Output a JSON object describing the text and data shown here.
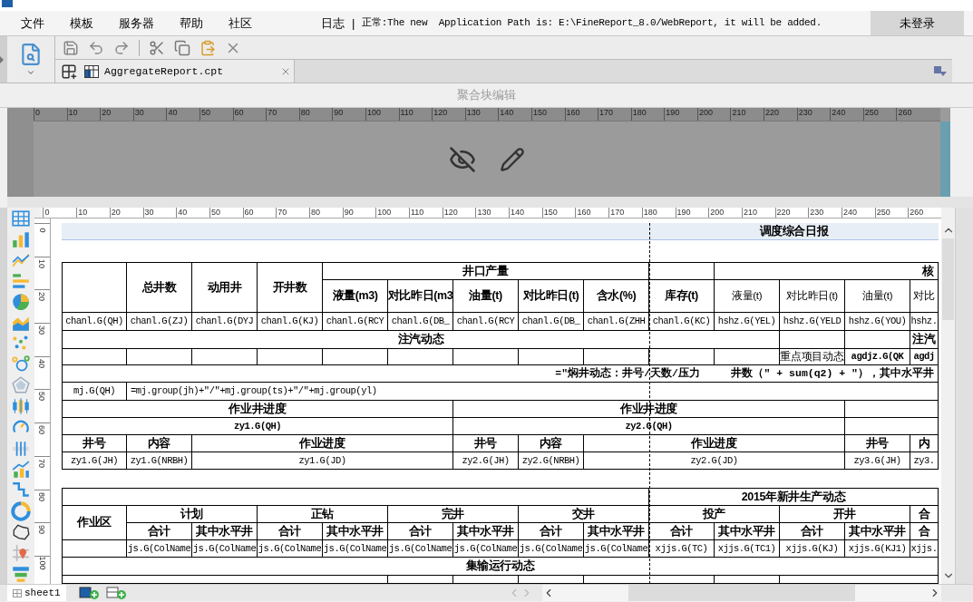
{
  "menu": [
    "文件",
    "模板",
    "服务器",
    "帮助",
    "社区"
  ],
  "log": {
    "label": "日志",
    "separator": "|",
    "message": "正常:The new  Application Path is: E:\\FineReport_8.0/WebReport, it will be added."
  },
  "login_button": "未登录",
  "tabs": [
    {
      "label": "AggregateReport.cpt",
      "selected": true
    }
  ],
  "block_title": "聚合块编辑",
  "block_ruler": [
    "0",
    "10",
    "20",
    "30",
    "40",
    "50",
    "60",
    "70",
    "80",
    "90",
    "100",
    "110",
    "120",
    "130",
    "140",
    "150",
    "160",
    "170",
    "180",
    "190",
    "200",
    "210",
    "220",
    "230",
    "240",
    "250",
    "260"
  ],
  "top_ruler": [
    "0",
    "10",
    "20",
    "30",
    "40",
    "50",
    "60",
    "70",
    "80",
    "90",
    "100",
    "110",
    "120",
    "130",
    "140",
    "150",
    "160",
    "170",
    "180",
    "190",
    "200",
    "210",
    "220",
    "230",
    "240",
    "250",
    "260"
  ],
  "side_ruler": [
    "0",
    "10",
    "20",
    "30",
    "40",
    "50",
    "60",
    "70",
    "80",
    "90",
    "100"
  ],
  "grid": {
    "rows": [
      {
        "kind": "band",
        "cells": [
          {
            "kind": "empty"
          },
          {
            "text": "调度综合日报",
            "kind": "header"
          }
        ]
      },
      {
        "kind": "blank"
      },
      {
        "kind": "cells",
        "cells": [
          {
            "kind": "empty"
          },
          {
            "text": "总井数",
            "kind": "header"
          },
          {
            "text": "动用井",
            "kind": "header"
          },
          {
            "text": "开井数",
            "kind": "header"
          },
          {
            "text": "井口产量",
            "kind": "header"
          },
          {
            "kind": "empty"
          },
          {
            "text": "核",
            "kind": "header"
          }
        ]
      },
      {
        "kind": "cells",
        "cells": [
          {
            "text": "液量(m3)",
            "kind": "header"
          },
          {
            "text": "对比昨日(m3",
            "kind": "header"
          },
          {
            "text": "油量(t)",
            "kind": "header"
          },
          {
            "text": "对比昨日(t)",
            "kind": "header"
          },
          {
            "text": "含水(%)",
            "kind": "header"
          },
          {
            "text": "库存(t)",
            "kind": "header"
          },
          {
            "text": "液量(t)",
            "kind": "label"
          },
          {
            "text": "对比昨日(t)",
            "kind": "label"
          },
          {
            "text": "油量(t)",
            "kind": "label"
          },
          {
            "text": "对比",
            "kind": "label"
          }
        ]
      },
      {
        "kind": "cells",
        "cells": [
          {
            "text": "chanl.G(QH)",
            "kind": "field"
          },
          {
            "text": "chanl.G(ZJ)",
            "kind": "field"
          },
          {
            "text": "chanl.G(DYJ",
            "kind": "field"
          },
          {
            "text": "chanl.G(KJ)",
            "kind": "field"
          },
          {
            "text": "chanl.G(RCY",
            "kind": "field"
          },
          {
            "text": "chanl.G(DB_",
            "kind": "field"
          },
          {
            "text": "chanl.G(RCY",
            "kind": "field"
          },
          {
            "text": "chanl.G(DB_",
            "kind": "field"
          },
          {
            "text": "chanl.G(ZHH",
            "kind": "field"
          },
          {
            "text": "chanl.G(KC)",
            "kind": "field"
          },
          {
            "text": "hshz.G(YEL)",
            "kind": "field"
          },
          {
            "text": "hshz.G(YELD",
            "kind": "field"
          },
          {
            "text": "hshz.G(YOU)",
            "kind": "field"
          },
          {
            "text": "hshz.",
            "kind": "field"
          }
        ]
      },
      {
        "kind": "cells",
        "cells": [
          {
            "text": "注汽动态",
            "kind": "header"
          },
          {
            "kind": "empty"
          },
          {
            "kind": "empty"
          },
          {
            "text": "注汽",
            "kind": "header"
          }
        ]
      },
      {
        "kind": "cells",
        "cells": [
          {
            "kind": "empty"
          },
          {
            "kind": "empty"
          },
          {
            "kind": "empty"
          },
          {
            "kind": "empty"
          },
          {
            "kind": "empty"
          },
          {
            "kind": "empty"
          },
          {
            "kind": "empty"
          },
          {
            "kind": "empty"
          },
          {
            "kind": "empty"
          },
          {
            "kind": "empty"
          },
          {
            "kind": "empty"
          },
          {
            "text": "重点项目动态",
            "kind": "label"
          },
          {
            "text": "agdjz.G(QK",
            "kind": "field-bold"
          },
          {
            "text": "agdj",
            "kind": "field-bold"
          }
        ]
      },
      {
        "kind": "cells",
        "cells": [
          {
            "text": "=\"焖井动态：井号/天数/压力     井数（\" + sum(q2) + \"），其中水平井",
            "kind": "formula-bold"
          }
        ]
      },
      {
        "kind": "cells",
        "cells": [
          {
            "text": "mj.G(QH)",
            "kind": "field"
          },
          {
            "text": "=mj.group(jh)+\"/\"+mj.group(ts)+\"/\"+mj.group(yl)",
            "kind": "field"
          }
        ]
      },
      {
        "kind": "cells",
        "cells": [
          {
            "text": "作业井进度",
            "kind": "header"
          },
          {
            "text": "作业井进度",
            "kind": "header"
          },
          {
            "kind": "empty"
          }
        ]
      },
      {
        "kind": "cells",
        "cells": [
          {
            "text": "zy1.G(QH)",
            "kind": "field-bold"
          },
          {
            "text": "zy2.G(QH)",
            "kind": "field-bold"
          },
          {
            "kind": "empty"
          }
        ]
      },
      {
        "kind": "cells",
        "cells": [
          {
            "text": "井号",
            "kind": "header"
          },
          {
            "text": "内容",
            "kind": "header"
          },
          {
            "text": "作业进度",
            "kind": "header"
          },
          {
            "text": "井号",
            "kind": "header"
          },
          {
            "text": "内容",
            "kind": "header"
          },
          {
            "text": "作业进度",
            "kind": "header"
          },
          {
            "text": "井号",
            "kind": "header"
          },
          {
            "text": "内",
            "kind": "header"
          }
        ]
      },
      {
        "kind": "cells",
        "cells": [
          {
            "text": "zy1.G(JH)",
            "kind": "field"
          },
          {
            "text": "zy1.G(NRBH)",
            "kind": "field"
          },
          {
            "text": "zy1.G(JD)",
            "kind": "field"
          },
          {
            "text": "zy2.G(JH)",
            "kind": "field"
          },
          {
            "text": "zy2.G(NRBH)",
            "kind": "field"
          },
          {
            "text": "zy2.G(JD)",
            "kind": "field"
          },
          {
            "text": "zy3.G(JH)",
            "kind": "field"
          },
          {
            "text": "zy3.",
            "kind": "field"
          }
        ]
      },
      {
        "kind": "blank"
      },
      {
        "kind": "cells",
        "cells": [
          {
            "kind": "empty"
          },
          {
            "text": "2015年新井生产动态",
            "kind": "header"
          }
        ]
      },
      {
        "kind": "cells",
        "cells": [
          {
            "text": "作业区",
            "kind": "header"
          },
          {
            "text": "计划",
            "kind": "header"
          },
          {
            "text": "正钻",
            "kind": "header"
          },
          {
            "text": "完井",
            "kind": "header"
          },
          {
            "text": "交井",
            "kind": "header"
          },
          {
            "text": "投产",
            "kind": "header"
          },
          {
            "text": "开井",
            "kind": "header"
          },
          {
            "text": "合",
            "kind": "header"
          }
        ]
      },
      {
        "kind": "cells",
        "cells": [
          {
            "text": "合计",
            "kind": "header"
          },
          {
            "text": "其中水平井",
            "kind": "header"
          },
          {
            "text": "合计",
            "kind": "header"
          },
          {
            "text": "其中水平井",
            "kind": "header"
          },
          {
            "text": "合计",
            "kind": "header"
          },
          {
            "text": "其中水平井",
            "kind": "header"
          },
          {
            "text": "合计",
            "kind": "header"
          },
          {
            "text": "其中水平井",
            "kind": "header"
          },
          {
            "text": "合计",
            "kind": "header"
          },
          {
            "text": "其中水平井",
            "kind": "header"
          },
          {
            "text": "合计",
            "kind": "header"
          },
          {
            "text": "其中水平井",
            "kind": "header"
          },
          {
            "text": "合",
            "kind": "header"
          }
        ]
      },
      {
        "kind": "cells",
        "cells": [
          {
            "kind": "empty"
          },
          {
            "text": "js.G(ColName",
            "kind": "field"
          },
          {
            "text": "js.G(ColName",
            "kind": "field"
          },
          {
            "text": "js.G(ColName",
            "kind": "field"
          },
          {
            "text": "js.G(ColName",
            "kind": "field"
          },
          {
            "text": "js.G(ColName",
            "kind": "field"
          },
          {
            "text": "js.G(ColName",
            "kind": "field"
          },
          {
            "text": "js.G(ColName",
            "kind": "field"
          },
          {
            "text": "js.G(ColName",
            "kind": "field"
          },
          {
            "text": "xjjs.G(TC)",
            "kind": "field"
          },
          {
            "text": "xjjs.G(TC1)",
            "kind": "field"
          },
          {
            "text": "xjjs.G(KJ)",
            "kind": "field"
          },
          {
            "text": "xjjs.G(KJ1)",
            "kind": "field"
          },
          {
            "text": "xjjs.",
            "kind": "field"
          }
        ]
      },
      {
        "kind": "cells",
        "cells": [
          {
            "text": "集输运行动态",
            "kind": "header"
          }
        ]
      },
      {
        "kind": "cells",
        "cells": [
          {
            "kind": "empty"
          },
          {
            "kind": "empty"
          },
          {
            "kind": "empty"
          },
          {
            "kind": "empty"
          },
          {
            "kind": "empty"
          },
          {
            "kind": "empty"
          },
          {
            "kind": "empty"
          }
        ]
      }
    ]
  },
  "sheets": [
    {
      "label": "sheet1",
      "selected": true
    }
  ]
}
